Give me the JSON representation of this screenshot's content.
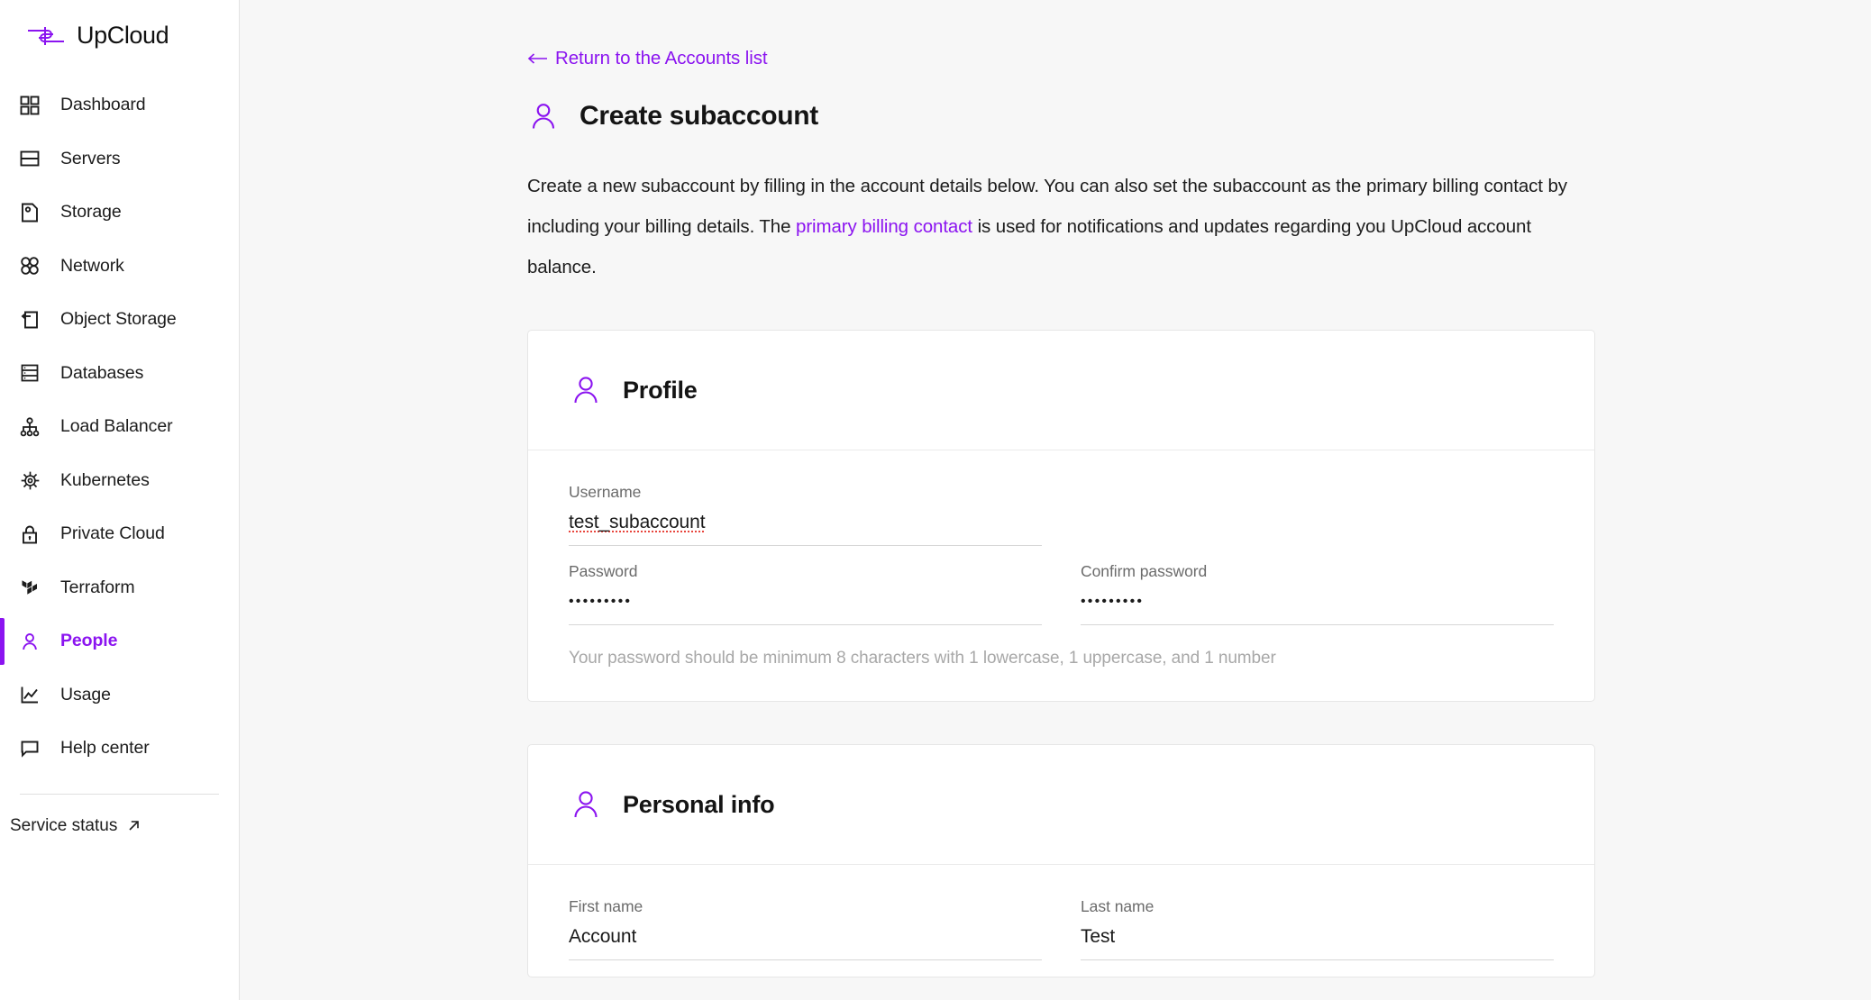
{
  "brand": {
    "name": "UpCloud",
    "logo_icon": "upcloud-logo-icon"
  },
  "sidebar": {
    "items": [
      {
        "label": "Dashboard",
        "icon": "grid-icon",
        "active": false
      },
      {
        "label": "Servers",
        "icon": "server-icon",
        "active": false
      },
      {
        "label": "Storage",
        "icon": "storage-disk-icon",
        "active": false
      },
      {
        "label": "Network",
        "icon": "network-nodes-icon",
        "active": false
      },
      {
        "label": "Object Storage",
        "icon": "object-storage-icon",
        "active": false
      },
      {
        "label": "Databases",
        "icon": "database-icon",
        "active": false
      },
      {
        "label": "Load Balancer",
        "icon": "load-balancer-icon",
        "active": false
      },
      {
        "label": "Kubernetes",
        "icon": "kubernetes-helm-icon",
        "active": false
      },
      {
        "label": "Private Cloud",
        "icon": "lock-icon",
        "active": false
      },
      {
        "label": "Terraform",
        "icon": "terraform-icon",
        "active": false
      },
      {
        "label": "People",
        "icon": "person-icon",
        "active": true
      },
      {
        "label": "Usage",
        "icon": "chart-line-icon",
        "active": false
      },
      {
        "label": "Help center",
        "icon": "speech-bubble-icon",
        "active": false
      }
    ],
    "service_status": {
      "label": "Service status",
      "icon": "external-link-arrow-icon"
    },
    "accent_color": "#8b14f0"
  },
  "main": {
    "return_link": {
      "label": "Return to the Accounts list",
      "icon": "arrow-left-icon"
    },
    "page_title": "Create subaccount",
    "page_title_icon": "person-icon",
    "description": {
      "part1": "Create a new subaccount by filling in the account details below. You can also set the subaccount as the primary billing contact by including your billing details. The ",
      "link": "primary billing contact",
      "part2": " is used for notifications and updates regarding you UpCloud account balance."
    },
    "cards": [
      {
        "title": "Profile",
        "icon": "person-icon",
        "fields": {
          "username": {
            "label": "Username",
            "value": "test_subaccount"
          },
          "password": {
            "label": "Password",
            "value": "•••••••••"
          },
          "confirm_password": {
            "label": "Confirm password",
            "value": "•••••••••"
          }
        },
        "hint": "Your password should be minimum 8 characters with 1 lowercase, 1 uppercase, and 1 number"
      },
      {
        "title": "Personal info",
        "icon": "person-icon",
        "fields": {
          "first_name": {
            "label": "First name",
            "value": "Account"
          },
          "last_name": {
            "label": "Last name",
            "value": "Test"
          }
        }
      }
    ]
  },
  "widgets": {
    "chat_launcher": {
      "icon": "chat-bubble-icon",
      "color": "#7a14f5"
    },
    "user_avatar": {
      "icon": "avatar-icon",
      "color": "#8b14f0"
    }
  }
}
